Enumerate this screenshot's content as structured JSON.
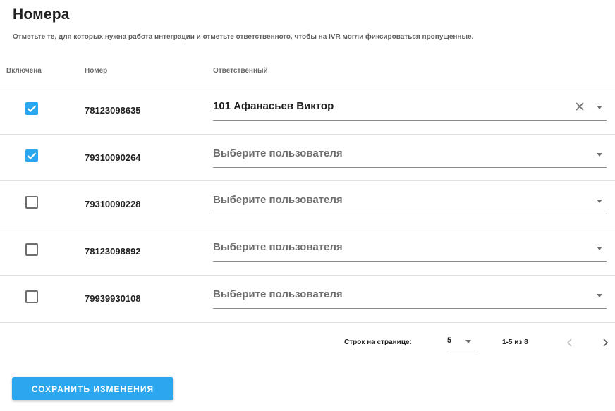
{
  "page": {
    "title": "Номера",
    "subtitle": "Отметьте те, для которых нужна работа интеграции и отметьте ответственного, чтобы на IVR могли фиксироваться пропущенные."
  },
  "table": {
    "headers": {
      "enabled": "Включена",
      "number": "Номер",
      "responsible": "Ответственный"
    },
    "rows": [
      {
        "enabled": true,
        "number": "78123098635",
        "responsible": "101 Афанасьев Виктор",
        "placeholder": "Выберите пользователя"
      },
      {
        "enabled": true,
        "number": "79310090264",
        "responsible": "",
        "placeholder": "Выберите пользователя"
      },
      {
        "enabled": false,
        "number": "79310090228",
        "responsible": "",
        "placeholder": "Выберите пользователя"
      },
      {
        "enabled": false,
        "number": "78123098892",
        "responsible": "",
        "placeholder": "Выберите пользователя"
      },
      {
        "enabled": false,
        "number": "79939930108",
        "responsible": "",
        "placeholder": "Выберите пользователя"
      }
    ]
  },
  "pagination": {
    "rows_per_page_label": "Строк на странице:",
    "rows_per_page": "5",
    "range": "1-5 из 8"
  },
  "actions": {
    "save_label": "СОХРАНИТЬ ИЗМЕНЕНИЯ"
  },
  "colors": {
    "accent": "#2aa7ee",
    "divider": "#e2e2e2",
    "placeholder": "#6d6d6d"
  },
  "icons": {
    "checked": "check-icon",
    "clear": "close-icon",
    "dropdown": "caret-down-icon",
    "prev": "chevron-left-icon",
    "next": "chevron-right-icon"
  }
}
